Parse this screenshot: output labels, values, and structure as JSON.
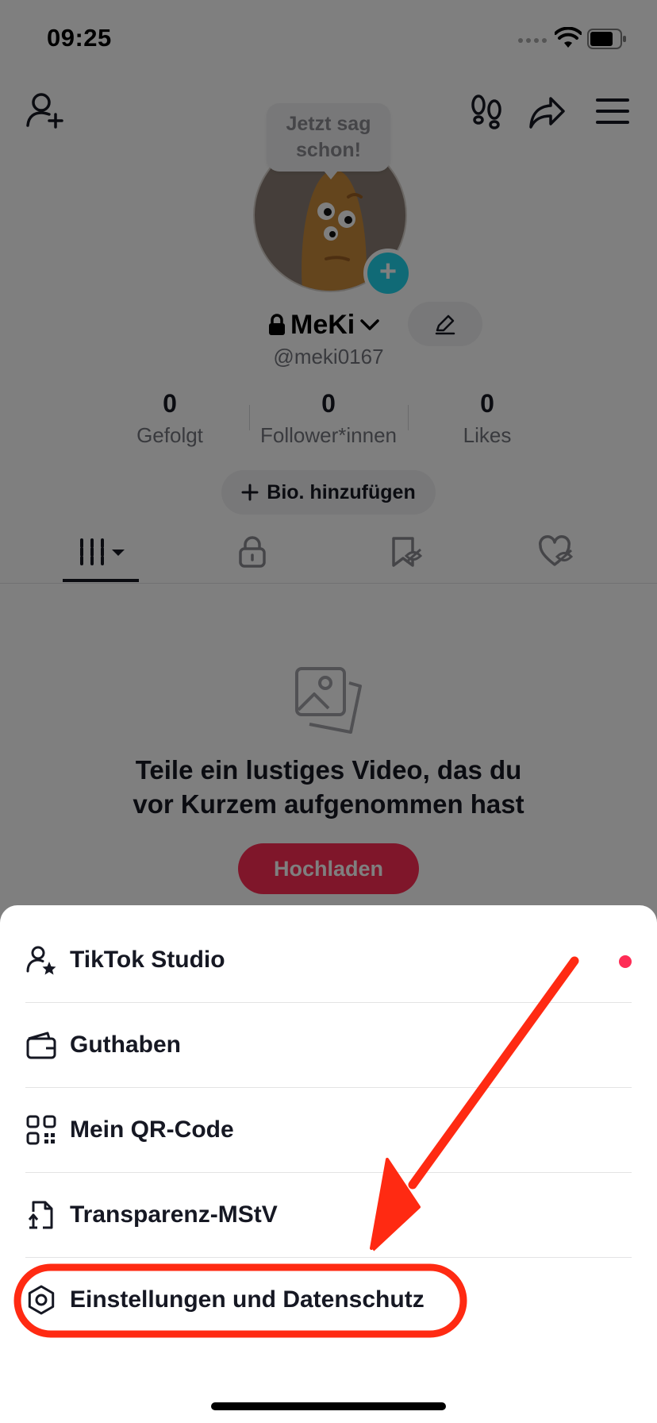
{
  "status_bar": {
    "time": "09:25"
  },
  "profile": {
    "speech_bubble": "Jetzt sag schon!",
    "display_name": "MeKi",
    "handle": "@meki0167",
    "stats": [
      {
        "value": "0",
        "label": "Gefolgt"
      },
      {
        "value": "0",
        "label": "Follower*innen"
      },
      {
        "value": "0",
        "label": "Likes"
      }
    ],
    "bio_button": "Bio. hinzufügen"
  },
  "empty_state": {
    "title": "Teile ein lustiges Video, das du vor Kurzem aufgenommen hast",
    "upload_button": "Hochladen"
  },
  "menu": {
    "items": [
      {
        "label": "TikTok Studio",
        "icon": "person-star-icon",
        "badge_dot": true
      },
      {
        "label": "Guthaben",
        "icon": "wallet-icon"
      },
      {
        "label": "Mein QR-Code",
        "icon": "qr-code-icon"
      },
      {
        "label": "Transparenz-MStV",
        "icon": "document-scale-icon"
      },
      {
        "label": "Einstellungen und Datenschutz",
        "icon": "gear-icon",
        "highlighted": true
      }
    ]
  },
  "colors": {
    "accent": "#fe2c55",
    "annotation": "#ff2a12",
    "avatar_plus": "#20d5ec",
    "text_primary": "#161823",
    "text_secondary": "#73757c"
  }
}
